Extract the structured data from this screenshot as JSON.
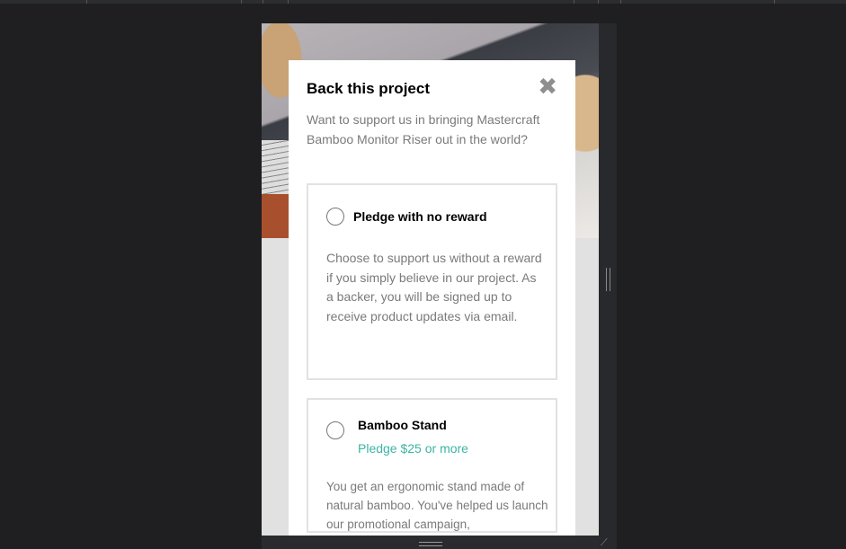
{
  "modal": {
    "title": "Back this project",
    "intro": "Want to support us in bringing Mastercraft Bamboo Monitor Riser out in the world?",
    "options": [
      {
        "name": "Pledge with no reward",
        "description": "Choose to support us without a reward if you simply believe in our project. As a backer, you will be signed up to receive product updates via email."
      },
      {
        "name": "Bamboo Stand",
        "pledge": "Pledge $25 or more",
        "description": "You get an ergonomic stand made of natural bamboo. You've helped us launch our promotional campaign,"
      }
    ]
  },
  "colors": {
    "accent": "#3cb4a4"
  }
}
